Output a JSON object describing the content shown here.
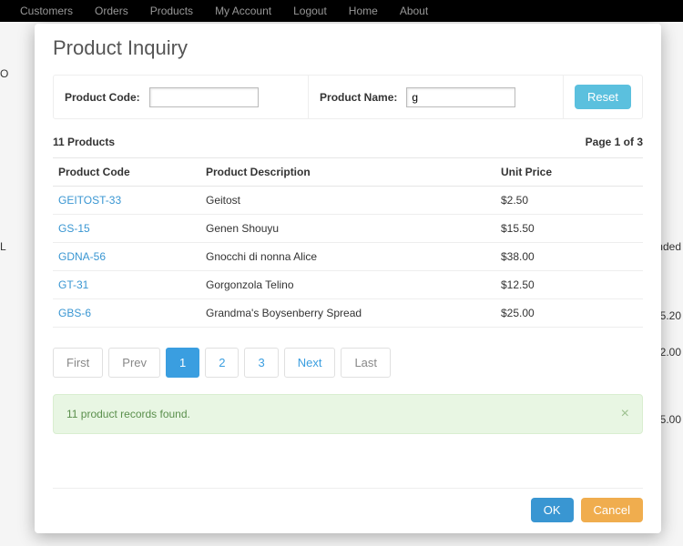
{
  "nav": {
    "items": [
      "Customers",
      "Orders",
      "Products",
      "My Account",
      "Logout",
      "Home",
      "About"
    ]
  },
  "bg": {
    "ended": "ended",
    "v1": "5.20",
    "v2": "2.00",
    "v3": "5.00",
    "letterL": "L",
    "letterO": "O"
  },
  "modal": {
    "title": "Product Inquiry",
    "search": {
      "code_label": "Product Code:",
      "code_value": "",
      "name_label": "Product Name:",
      "name_value": "g",
      "reset": "Reset"
    },
    "summary": {
      "count": "11 Products",
      "page": "Page 1 of  3"
    },
    "columns": {
      "code": "Product Code",
      "desc": "Product Description",
      "price": "Unit Price"
    },
    "rows": [
      {
        "code": "GEITOST-33",
        "desc": "Geitost",
        "price": "$2.50"
      },
      {
        "code": "GS-15",
        "desc": "Genen Shouyu",
        "price": "$15.50"
      },
      {
        "code": "GDNA-56",
        "desc": "Gnocchi di nonna Alice",
        "price": "$38.00"
      },
      {
        "code": "GT-31",
        "desc": "Gorgonzola Telino",
        "price": "$12.50"
      },
      {
        "code": "GBS-6",
        "desc": "Grandma's Boysenberry Spread",
        "price": "$25.00"
      }
    ],
    "pagination": {
      "first": "First",
      "prev": "Prev",
      "p1": "1",
      "p2": "2",
      "p3": "3",
      "next": "Next",
      "last": "Last"
    },
    "alert": "11 product records found.",
    "footer": {
      "ok": "OK",
      "cancel": "Cancel"
    }
  }
}
